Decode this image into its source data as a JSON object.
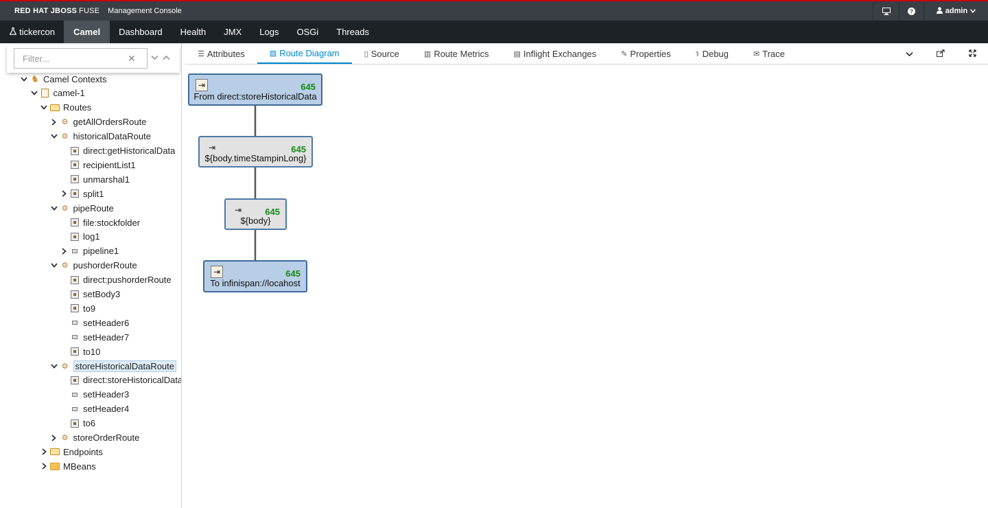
{
  "brand": {
    "name": "RED HAT JBOSS",
    "product": "FUSE",
    "console": "Management Console"
  },
  "header": {
    "user": "admin"
  },
  "nav": {
    "app": "tickercon",
    "items": [
      "Camel",
      "Dashboard",
      "Health",
      "JMX",
      "Logs",
      "OSGi",
      "Threads"
    ],
    "active": "Camel"
  },
  "filter": {
    "placeholder": "Filter...",
    "value": ""
  },
  "tree": [
    {
      "label": "Camel Contexts",
      "level": 0,
      "expanded": true,
      "icon": "camel-icon"
    },
    {
      "label": "camel-1",
      "level": 1,
      "expanded": true,
      "icon": "context-icon"
    },
    {
      "label": "Routes",
      "level": 2,
      "expanded": true,
      "icon": "folder-open-icon"
    },
    {
      "label": "getAllOrdersRoute",
      "level": 3,
      "expanded": false,
      "icon": "route-icon"
    },
    {
      "label": "historicalDataRoute",
      "level": 3,
      "expanded": true,
      "icon": "route-icon"
    },
    {
      "label": "direct:getHistoricalData",
      "level": 4,
      "icon": "endpoint-icon"
    },
    {
      "label": "recipientList1",
      "level": 4,
      "icon": "recipient-list-icon"
    },
    {
      "label": "unmarshal1",
      "level": 4,
      "icon": "unmarshal-icon"
    },
    {
      "label": "split1",
      "level": 4,
      "expanded": false,
      "icon": "split-icon"
    },
    {
      "label": "pipeRoute",
      "level": 3,
      "expanded": true,
      "icon": "route-icon"
    },
    {
      "label": "file:stockfolder",
      "level": 4,
      "icon": "endpoint-icon"
    },
    {
      "label": "log1",
      "level": 4,
      "icon": "log-icon"
    },
    {
      "label": "pipeline1",
      "level": 4,
      "expanded": false,
      "icon": "pipeline-icon"
    },
    {
      "label": "pushorderRoute",
      "level": 3,
      "expanded": true,
      "icon": "route-icon"
    },
    {
      "label": "direct:pushorderRoute",
      "level": 4,
      "icon": "endpoint-icon"
    },
    {
      "label": "setBody3",
      "level": 4,
      "icon": "setbody-icon"
    },
    {
      "label": "to9",
      "level": 4,
      "icon": "endpoint-icon"
    },
    {
      "label": "setHeader6",
      "level": 4,
      "icon": "setheader-icon"
    },
    {
      "label": "setHeader7",
      "level": 4,
      "icon": "setheader-icon"
    },
    {
      "label": "to10",
      "level": 4,
      "icon": "endpoint-icon"
    },
    {
      "label": "storeHistoricalDataRoute",
      "level": 3,
      "expanded": true,
      "selected": true,
      "icon": "route-icon"
    },
    {
      "label": "direct:storeHistoricalData",
      "level": 4,
      "icon": "endpoint-icon"
    },
    {
      "label": "setHeader3",
      "level": 4,
      "icon": "setheader-icon"
    },
    {
      "label": "setHeader4",
      "level": 4,
      "icon": "setheader-icon"
    },
    {
      "label": "to6",
      "level": 4,
      "icon": "endpoint-icon"
    },
    {
      "label": "storeOrderRoute",
      "level": 3,
      "expanded": false,
      "icon": "route-icon"
    },
    {
      "label": "Endpoints",
      "level": 2,
      "expanded": false,
      "icon": "folder-open-icon"
    },
    {
      "label": "MBeans",
      "level": 2,
      "expanded": false,
      "icon": "folder-icon"
    }
  ],
  "tabs": [
    {
      "label": "Attributes",
      "icon": "list-icon"
    },
    {
      "label": "Route Diagram",
      "icon": "image-icon",
      "active": true
    },
    {
      "label": "Source",
      "icon": "file-icon"
    },
    {
      "label": "Route Metrics",
      "icon": "bar-chart-icon"
    },
    {
      "label": "Inflight Exchanges",
      "icon": "list-alt-icon"
    },
    {
      "label": "Properties",
      "icon": "edit-icon"
    },
    {
      "label": "Debug",
      "icon": "stethoscope-icon"
    },
    {
      "label": "Trace",
      "icon": "envelope-icon"
    }
  ],
  "diagram": {
    "nodes": [
      {
        "label": "From direct:storeHistoricalData",
        "count": "645",
        "type": "from"
      },
      {
        "label": "${body.timeStampinLong}",
        "count": "645",
        "type": "setHeader"
      },
      {
        "label": "${body}",
        "count": "645",
        "type": "setHeader"
      },
      {
        "label": "To infinispan://locahost",
        "count": "645",
        "type": "to"
      }
    ]
  }
}
